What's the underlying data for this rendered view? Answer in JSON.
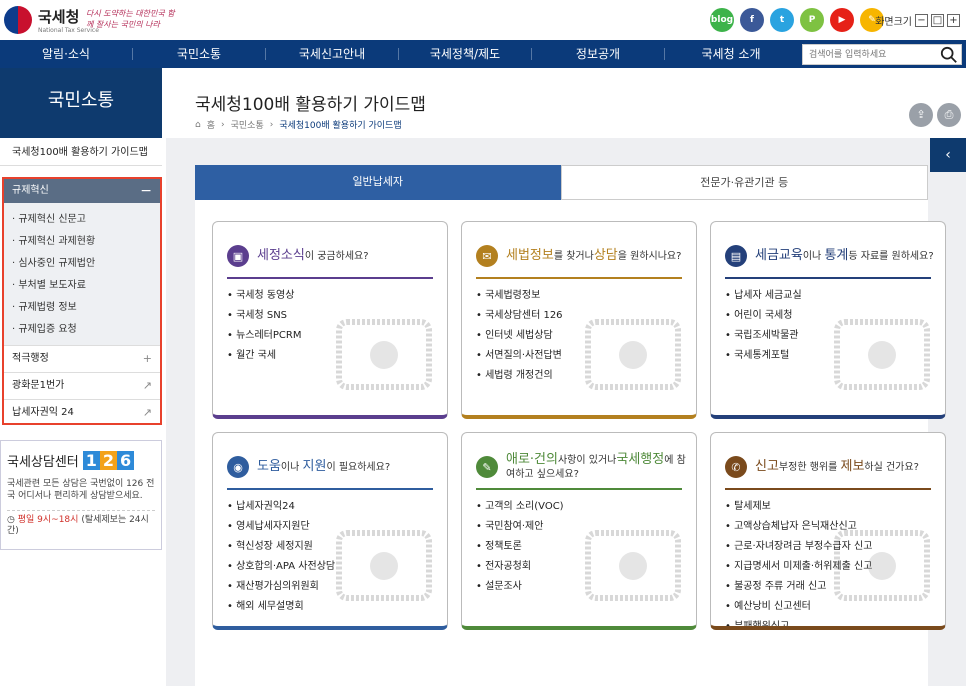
{
  "header": {
    "logo_name": "국세청",
    "logo_sub": "National Tax Service",
    "slogan": "다시 도약하는 대한민국 함께 잘사는 국민의 나라",
    "sns": [
      {
        "label": "blog",
        "color": "#3db34a"
      },
      {
        "label": "f",
        "color": "#3b5998"
      },
      {
        "label": "t",
        "color": "#2aa3e0"
      },
      {
        "label": "P",
        "color": "#7ec242"
      },
      {
        "label": "▶",
        "color": "#e62117"
      },
      {
        "label": "✎",
        "color": "#f7b500"
      }
    ],
    "zoom_label": "화면크기",
    "zoom_minus": "−",
    "zoom_reset": "□",
    "zoom_plus": "+"
  },
  "gnb": {
    "items": [
      "알림·소식",
      "국민소통",
      "국세신고안내",
      "국세정책/제도",
      "정보공개",
      "국세청 소개"
    ],
    "search_placeholder": "검색어를 입력하세요"
  },
  "lnb": {
    "title": "국민소통",
    "top_item": "국세청100배 활용하기 가이드맵",
    "group_label": "규제혁신",
    "group_toggle": "−",
    "group_items": [
      "규제혁신 신문고",
      "규제혁신 과제현황",
      "심사중인 규제법안",
      "부처별 보도자료",
      "규제법령 정보",
      "규제입증 요청"
    ],
    "rows": [
      {
        "label": "적극행정",
        "icon": "+"
      },
      {
        "label": "광화문1번가",
        "icon": "↗"
      },
      {
        "label": "납세자권익 24",
        "icon": "↗"
      }
    ]
  },
  "call_center": {
    "title": "국세상담센터",
    "digits": [
      "1",
      "2",
      "6"
    ],
    "desc": "국세관련 모든 상담은 국번없이 126 전국 어디서나 편리하게 상담받으세요.",
    "hours": "평일 9시~18시",
    "hours_note": "(탈세제보는 24시간)"
  },
  "main": {
    "title": "국세청100배 활용하기 가이드맵",
    "breadcrumb": [
      "홈",
      "국민소통",
      "국세청100배 활용하기 가이드맵"
    ],
    "share": "⇪",
    "print": "⎙",
    "panel_toggle": "‹",
    "tabs": [
      "일반납세자",
      "전문가·유관기관 등"
    ]
  },
  "cards": [
    {
      "color": "#5b3e8e",
      "icon": "▣",
      "hl1": "세정소식",
      "t1": "이 궁금하세요?",
      "hl2": "",
      "t2": "",
      "items": [
        "국세청 동영상",
        "국세청 SNS",
        "뉴스레터PCRM",
        "월간 국세"
      ]
    },
    {
      "color": "#b3801f",
      "icon": "✉",
      "hl1": "세법정보",
      "t1": "를 찾거나",
      "hl2": "상담",
      "t2": "을 원하시나요?",
      "items": [
        "국세법령정보",
        "국세상담센터 126",
        "인터넷 세법상담",
        "서면질의·사전답변",
        "세법령 개정건의"
      ]
    },
    {
      "color": "#24407a",
      "icon": "▤",
      "hl1": "세금교육",
      "t1": "이나 ",
      "hl2": "통계",
      "t2": "등 자료를 원하세요?",
      "items": [
        "납세자 세금교실",
        "어린이 국세청",
        "국립조세박물관",
        "국세통계포털"
      ]
    },
    {
      "color": "#2f5d9e",
      "icon": "◉",
      "hl1": "도움",
      "t1": "이나 ",
      "hl2": "지원",
      "t2": "이 필요하세요?",
      "items": [
        "납세자권익24",
        "영세납세자지원단",
        "혁신성장 세정지원",
        "상호합의·APA 사전상담",
        "재산평가심의위원회",
        "해외 세무설명회"
      ]
    },
    {
      "color": "#4f8a3a",
      "icon": "✎",
      "hl1": "애로·건의",
      "t1": "사항이 있거나",
      "hl2": "국세행정",
      "t2": "에 참여하고 싶으세요?",
      "items": [
        "고객의 소리(VOC)",
        "국민참여·제안",
        "정책토론",
        "전자공청회",
        "설문조사"
      ]
    },
    {
      "color": "#7a4a1c",
      "icon": "✆",
      "hl1": "신고",
      "t1": "부정한 행위를 ",
      "hl2": "제보",
      "t2": "하실 건가요?",
      "items": [
        "탈세제보",
        "고액상습체납자 은닉재산신고",
        "근로·자녀장려금 부정수급자 신고",
        "지급명세서 미제출·허위제출 신고",
        "불공정 주류 거래 신고",
        "예산낭비 신고센터",
        "부패행위신고"
      ]
    }
  ]
}
